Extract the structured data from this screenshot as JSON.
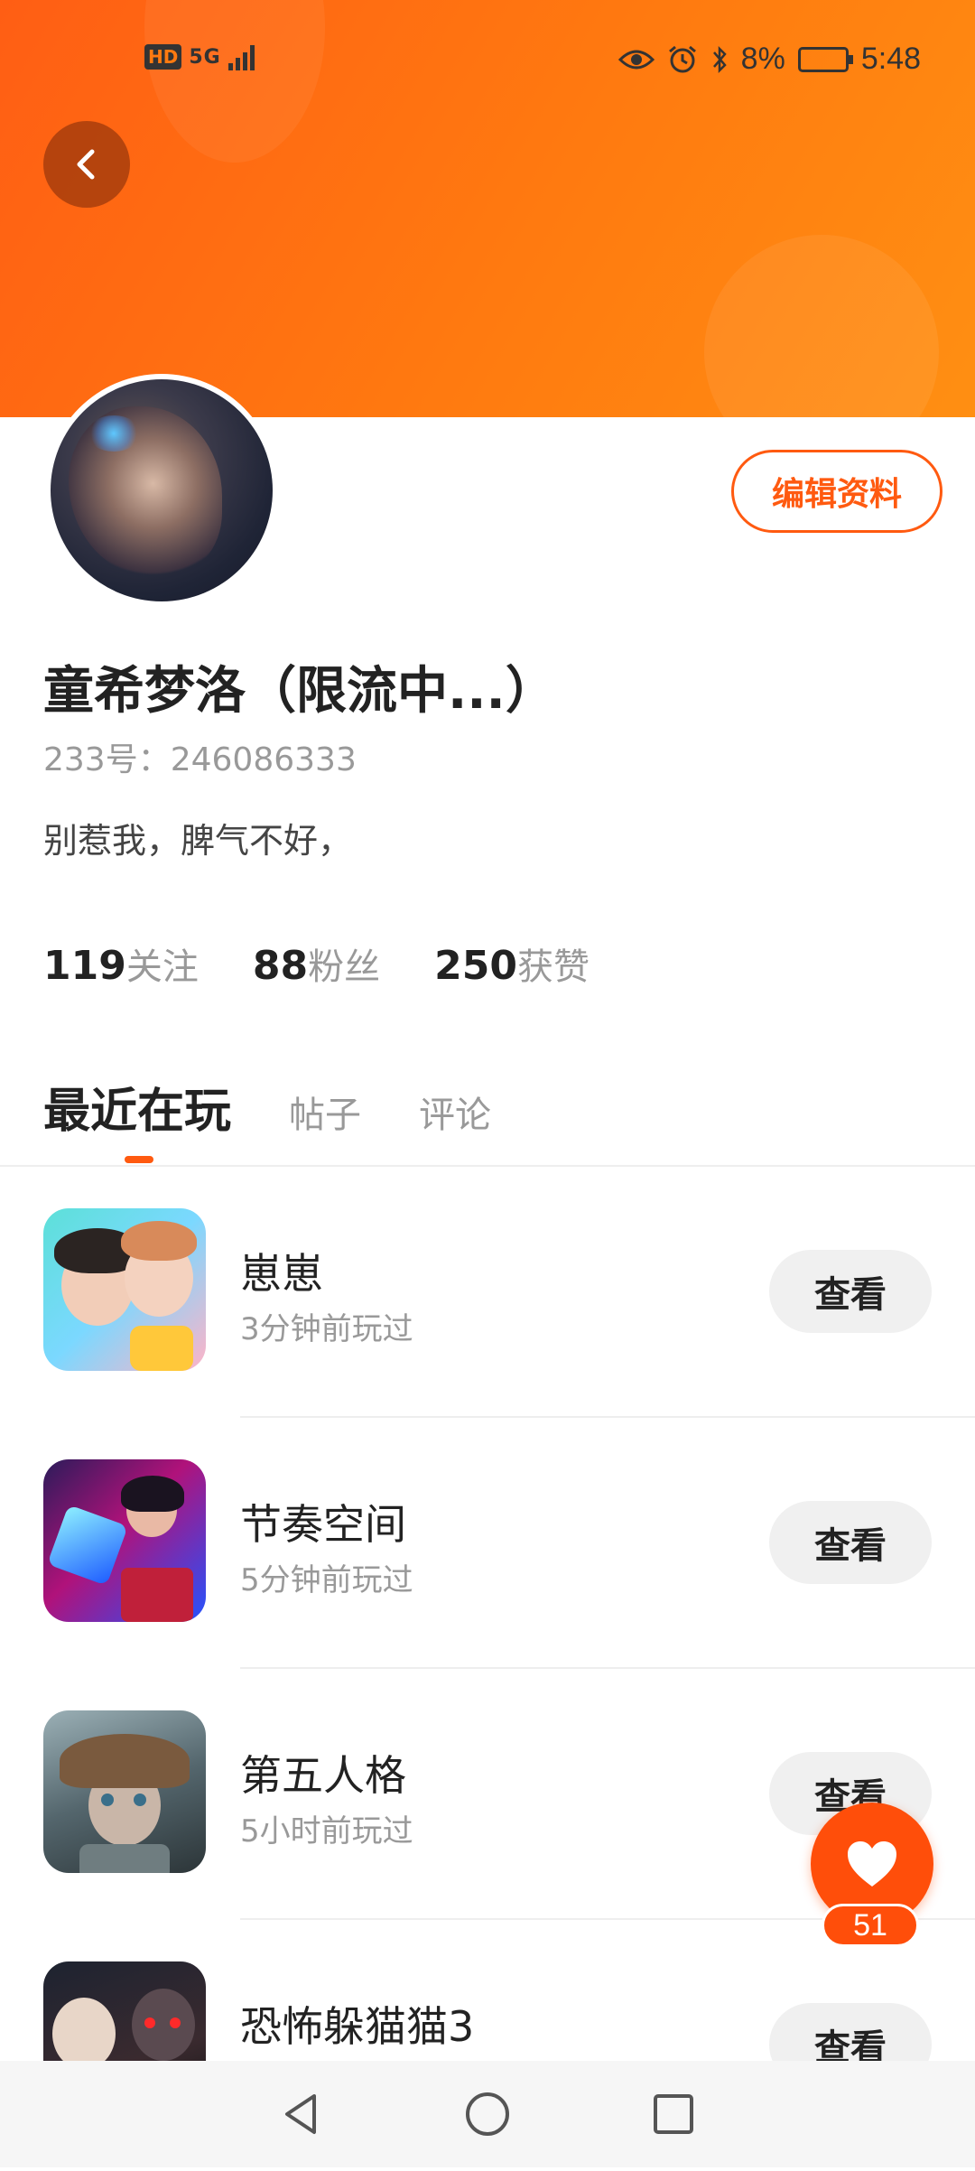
{
  "status_bar": {
    "left_badge": "HD",
    "signal": "5G",
    "battery": "8%",
    "time": "5:48"
  },
  "profile": {
    "name": "童希梦洛（限流中...）",
    "uid": "233号：246086333",
    "bio": "别惹我，脾气不好，",
    "edit_label": "编辑资料"
  },
  "stats": [
    {
      "num": "119",
      "label": "关注"
    },
    {
      "num": "88",
      "label": "粉丝"
    },
    {
      "num": "250",
      "label": "获赞"
    }
  ],
  "tabs": [
    {
      "label": "最近在玩",
      "active": true
    },
    {
      "label": "帖子",
      "active": false
    },
    {
      "label": "评论",
      "active": false
    }
  ],
  "games": [
    {
      "title": "崽崽",
      "sub": "3分钟前玩过",
      "button": "查看"
    },
    {
      "title": "节奏空间",
      "sub": "5分钟前玩过",
      "button": "查看"
    },
    {
      "title": "第五人格",
      "sub": "5小时前玩过",
      "button": "查看"
    },
    {
      "title": "恐怖躲猫猫3",
      "sub": "",
      "button": "查看"
    }
  ],
  "fab": {
    "count": "51",
    "icon": "heart-icon"
  },
  "colors": {
    "accent": "#ff5a10",
    "banner": "#ff7a10"
  }
}
